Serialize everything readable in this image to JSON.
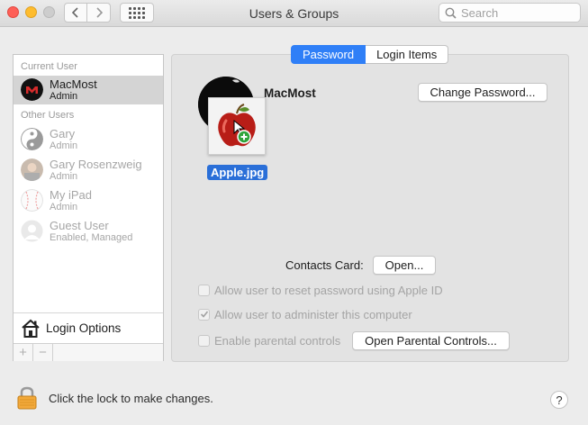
{
  "window": {
    "title": "Users & Groups"
  },
  "toolbar": {
    "search_placeholder": "Search"
  },
  "sidebar": {
    "current_user_header": "Current User",
    "other_users_header": "Other Users",
    "current_user": {
      "name": "MacMost",
      "role": "Admin"
    },
    "other_users": [
      {
        "name": "Gary",
        "role": "Admin"
      },
      {
        "name": "Gary Rosenzweig",
        "role": "Admin"
      },
      {
        "name": "My iPad",
        "role": "Admin"
      },
      {
        "name": "Guest User",
        "role": "Enabled, Managed"
      }
    ],
    "login_options": "Login Options",
    "add_symbol": "+",
    "remove_symbol": "−"
  },
  "tabs": {
    "password": "Password",
    "login_items": "Login Items"
  },
  "main": {
    "username": "MacMost",
    "change_password": "Change Password...",
    "drag_file_label": "Apple.jpg",
    "contacts_label": "Contacts Card:",
    "open_button": "Open...",
    "checkboxes": [
      {
        "label": "Allow user to reset password using Apple ID",
        "checked": false
      },
      {
        "label": "Allow user to administer this computer",
        "checked": true
      },
      {
        "label": "Enable parental controls",
        "checked": false
      }
    ],
    "open_parental_controls": "Open Parental Controls..."
  },
  "footer": {
    "lock_text": "Click the lock to make changes.",
    "help": "?"
  },
  "colors": {
    "accent": "#2f7ff7",
    "selection": "#2a6fd8"
  }
}
